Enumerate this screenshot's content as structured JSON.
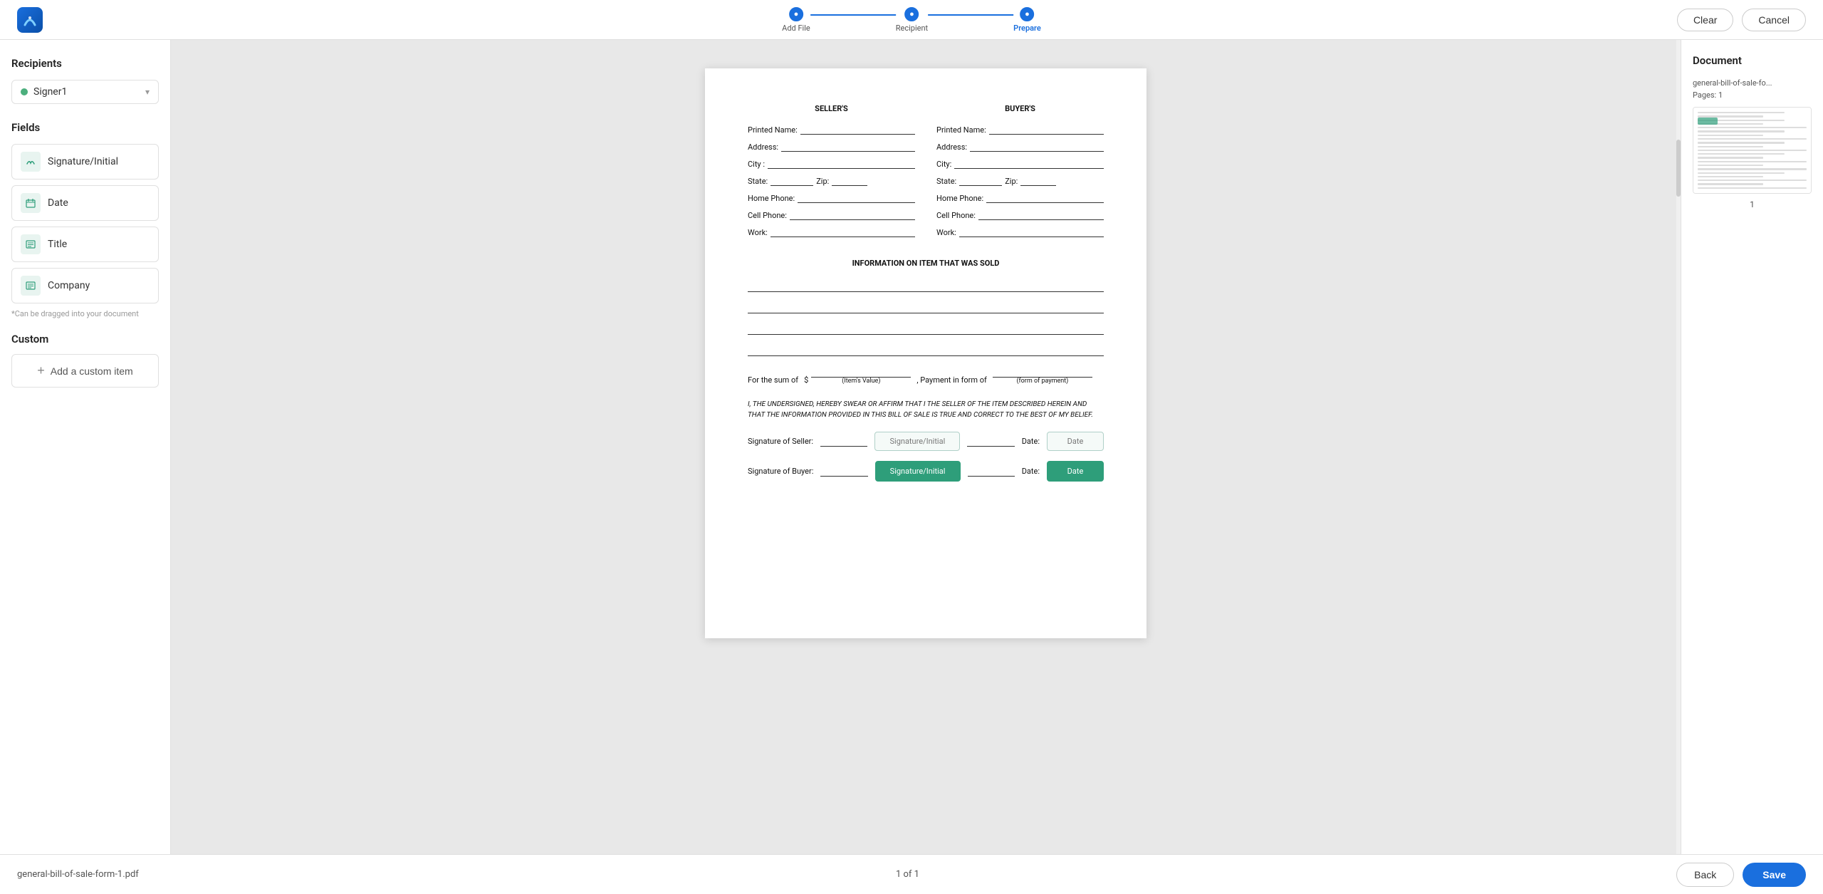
{
  "header": {
    "logo_alt": "App Logo",
    "steps": [
      {
        "label": "Add File",
        "state": "completed"
      },
      {
        "label": "Recipient",
        "state": "completed"
      },
      {
        "label": "Prepare",
        "state": "active"
      }
    ],
    "clear_label": "Clear",
    "cancel_label": "Cancel"
  },
  "sidebar": {
    "recipients_title": "Recipients",
    "signer_name": "Signer1",
    "fields_title": "Fields",
    "fields": [
      {
        "id": "sig",
        "label": "Signature/Initial",
        "icon": "✎"
      },
      {
        "id": "date",
        "label": "Date",
        "icon": "▦"
      },
      {
        "id": "title",
        "label": "Title",
        "icon": "▤"
      },
      {
        "id": "company",
        "label": "Company",
        "icon": "▤"
      }
    ],
    "drag_hint": "*Can be dragged into your document",
    "custom_title": "Custom",
    "add_custom_label": "Add a custom item"
  },
  "document": {
    "seller_header": "SELLER'S",
    "buyer_header": "BUYER'S",
    "seller_fields": [
      {
        "label": "Printed Name:"
      },
      {
        "label": "Address:"
      },
      {
        "label": "City :"
      },
      {
        "label_left": "State:",
        "label_right": "Zip:"
      },
      {
        "label": "Home Phone:"
      },
      {
        "label": "Cell Phone:"
      },
      {
        "label": "Work:"
      }
    ],
    "buyer_fields": [
      {
        "label": "Printed Name:"
      },
      {
        "label": "Address:"
      },
      {
        "label": "City:"
      },
      {
        "label_left": "State:",
        "label_right": "Zip:"
      },
      {
        "label": "Home Phone:"
      },
      {
        "label": "Cell Phone:"
      },
      {
        "label": "Work:"
      }
    ],
    "item_info_header": "INFORMATION ON ITEM THAT WAS SOLD",
    "payment_prefix": "For the sum of",
    "payment_symbol": "$",
    "payment_item_label": "(Item's Value)",
    "payment_conjunction": ", Payment in form of",
    "payment_form_label": "(form of payment)",
    "affidavit": "I, THE UNDERSIGNED, HEREBY SWEAR OR AFFIRM THAT I THE SELLER OF THE ITEM DESCRIBED HEREIN AND THAT THE INFORMATION PROVIDED IN THIS BILL OF SALE IS TRUE AND CORRECT TO THE BEST OF MY BELIEF.",
    "sig_seller_label": "Signature of Seller:",
    "sig_buyer_label": "Signature of Buyer:",
    "date_label": "Date:",
    "sig_initial_placeholder": "Signature/Initial",
    "sig_initial_filled": "Signature/Initial",
    "date_placeholder": "Date",
    "date_filled": "Date"
  },
  "right_panel": {
    "title": "Document",
    "file_name": "general-bill-of-sale-fo...",
    "pages_label": "Pages: 1",
    "page_number": "1"
  },
  "bottom_bar": {
    "filename": "general-bill-of-sale-form-1.pdf",
    "page_count": "1 of 1",
    "back_label": "Back",
    "save_label": "Save"
  }
}
